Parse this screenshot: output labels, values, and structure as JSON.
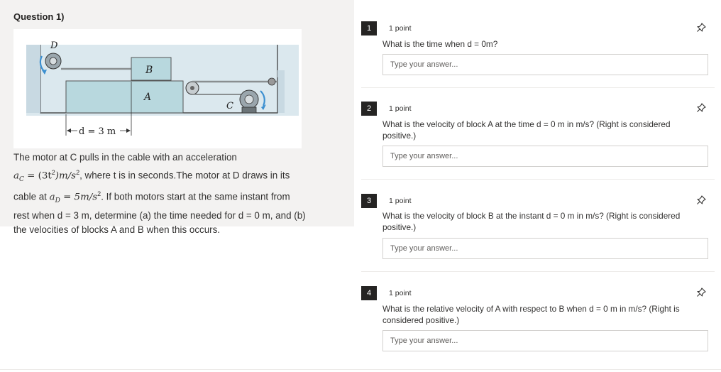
{
  "question": {
    "title": "Question 1)",
    "figure_labels": {
      "motor_d": "D",
      "block_b": "B",
      "block_a": "A",
      "motor_c": "C",
      "distance": "d = 3 m"
    },
    "problem": {
      "line1": "The motor at C pulls in the cable with an acceleration",
      "line2_math": "a",
      "line2_sub": "C",
      "line2_eq": " = (3t",
      "line2_eq2": ")m/s",
      "line2_text": ", where t is in seconds.The motor at D draws in its",
      "line3_text_a": "cable at ",
      "line3_math": "a",
      "line3_sub": "D",
      "line3_eq": " = 5m/s",
      "line3_text_b": ". If both motors start at the same instant from",
      "line4": "rest when d = 3 m, determine (a) the time needed for d = 0 m, and (b)",
      "line5": "the velocities of blocks A and B when this occurs.",
      "sup2": "2"
    }
  },
  "subquestions": [
    {
      "number": "1",
      "points": "1 point",
      "text": "What is the time when d = 0m?",
      "placeholder": "Type your answer..."
    },
    {
      "number": "2",
      "points": "1 point",
      "text": "What is the velocity of block A at the time d = 0 m in m/s? (Right is considered positive.)",
      "placeholder": "Type your answer..."
    },
    {
      "number": "3",
      "points": "1 point",
      "text": "What is the velocity of block B at the instant d = 0 m in m/s? (Right is considered positive.)",
      "placeholder": "Type your answer..."
    },
    {
      "number": "4",
      "points": "1 point",
      "text": "What is the relative velocity of A with respect to B when d = 0 m in m/s? (Right is considered positive.)",
      "placeholder": "Type your answer..."
    }
  ],
  "icons": {
    "pin": "pin-icon"
  },
  "colors": {
    "badge": "#252423",
    "panel": "#f3f2f1",
    "border": "#d2d0ce"
  }
}
